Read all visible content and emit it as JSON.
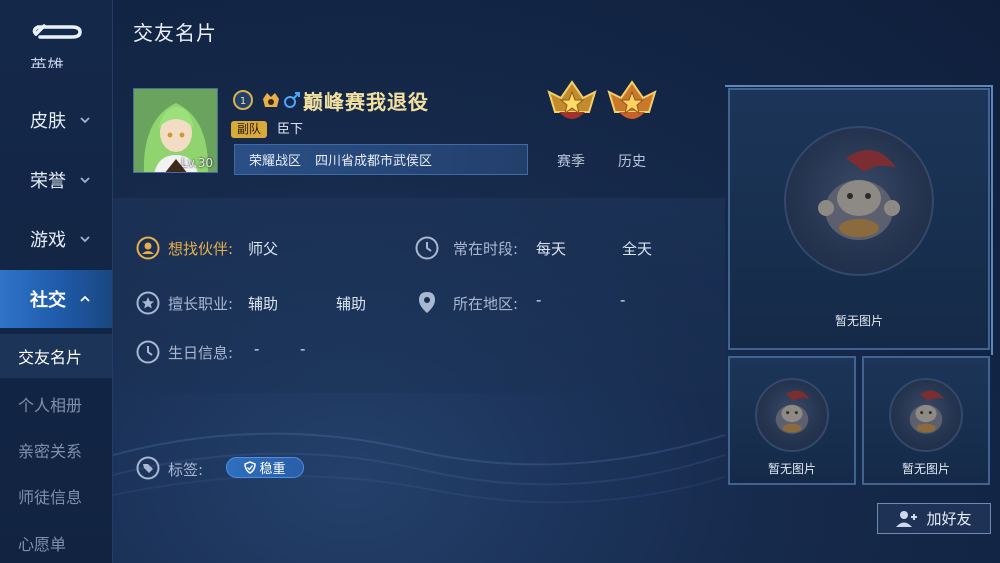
{
  "header": {
    "title": "交友名片"
  },
  "sidebar": {
    "cut_item": "英雄",
    "items": [
      {
        "label": "皮肤"
      },
      {
        "label": "荣誉"
      },
      {
        "label": "游戏"
      },
      {
        "label": "社交"
      }
    ],
    "sub_items": [
      {
        "label": "交友名片"
      },
      {
        "label": "个人相册"
      },
      {
        "label": "亲密关系"
      },
      {
        "label": "师徒信息"
      },
      {
        "label": "心愿单"
      }
    ]
  },
  "profile": {
    "name": "巅峰赛我退役",
    "level": "Lv.30",
    "badge_number": "1",
    "rank_tag": "副队",
    "rank_sub": "臣下",
    "zone": "荣耀战区",
    "location": "四川省成都市武侯区",
    "season_label": "赛季",
    "history_label": "历史"
  },
  "info": {
    "partner_label": "想找伙伴:",
    "partner_value": "师父",
    "online_label": "常在时段:",
    "online_day": "每天",
    "online_time": "全天",
    "role_label": "擅长职业:",
    "role_1": "辅助",
    "role_2": "辅助",
    "region_label": "所在地区:",
    "region_1": "-",
    "region_2": "-",
    "birthday_label": "生日信息:",
    "birthday_1": "-",
    "birthday_2": "-",
    "tags_label": "标签:",
    "tag_1": "稳重"
  },
  "photos": {
    "empty_caption": "暂无图片"
  },
  "actions": {
    "add_friend": "加好友"
  },
  "colors": {
    "accent_gold": "#e8b04a",
    "active_blue": "#2f74c8",
    "background": "#162a4c"
  }
}
